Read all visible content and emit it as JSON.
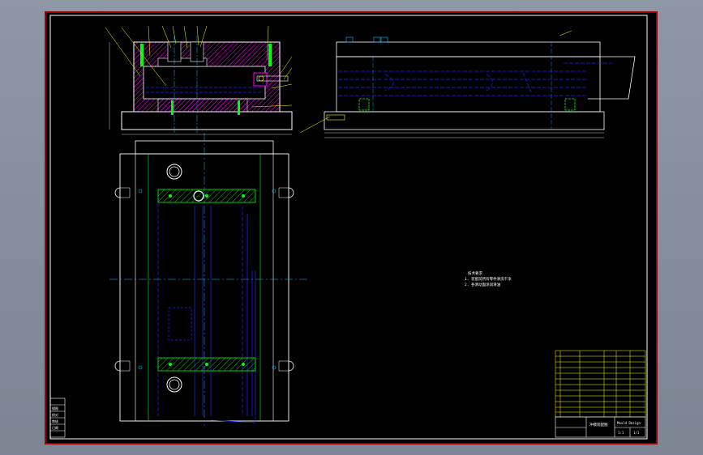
{
  "drawing": {
    "notes": [
      "技术要求",
      "1. 装配前所有零件清洗干净",
      "2. 各滑动面涂润滑油"
    ],
    "title_block": {
      "drawing_name": "冲模装配图",
      "school": "Mould Design",
      "scale": "1:1",
      "sheet": "1/1"
    },
    "left_stamp": {
      "rows": [
        "描图",
        "校对",
        "审核",
        "日期"
      ]
    },
    "colors": {
      "background": "#000000",
      "frame_outer": "#ff0000",
      "frame_inner": "#ffffff",
      "outline": "#ffffff",
      "hidden_line": "#2222ff",
      "center_line": "#00c8ff",
      "hatch": "#ff00ff",
      "leader": "#ffff00",
      "bolt": "#00ff00",
      "table": "#ffff00"
    }
  }
}
